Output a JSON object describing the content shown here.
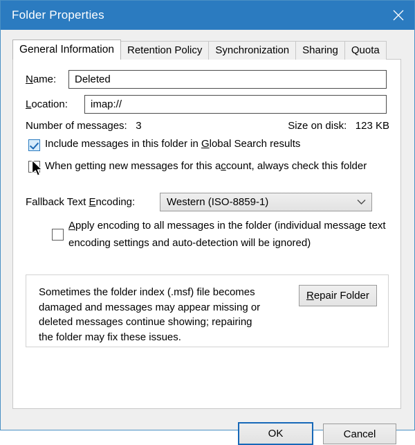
{
  "window": {
    "title": "Folder Properties",
    "close_label": "×",
    "titlebar_color": "#2b7bc0",
    "accent_color": "#1668b8"
  },
  "tabs": [
    {
      "label": "General Information",
      "active": true
    },
    {
      "label": "Retention Policy",
      "active": false
    },
    {
      "label": "Synchronization",
      "active": false
    },
    {
      "label": "Sharing",
      "active": false
    },
    {
      "label": "Quota",
      "active": false
    }
  ],
  "general": {
    "name_label_pre": "N",
    "name_label_accel": "N",
    "name_label": "Name:",
    "name_value": "Deleted",
    "location_label": "Location:",
    "location_value": "imap://",
    "count_label": "Number of messages:",
    "count_value": "3",
    "size_label": "Size on disk:",
    "size_value": "123 KB",
    "checkbox_global_search": {
      "label_a": "Include messages in this folder in ",
      "label_accel": "G",
      "label_b": "lobal Search results",
      "checked": true,
      "hovered": true
    },
    "checkbox_check_folder": {
      "label_a": "When getting new messages for this a",
      "label_accel": "c",
      "label_b": "count, always check this folder",
      "checked": false
    },
    "encoding_label_a": "Fallback Text ",
    "encoding_label_accel": "E",
    "encoding_label_b": "ncoding:",
    "encoding_value": "Western (ISO-8859-1)",
    "encoding_caret": "chevron-down-icon",
    "checkbox_apply_encoding": {
      "label_accel": "A",
      "label_b": "pply encoding to all messages in the folder (individual message text encoding settings and auto-detection will be ignored)",
      "checked": false
    },
    "repair_text": "Sometimes the folder index (.msf) file becomes damaged and messages may appear missing or deleted messages continue showing; repairing the folder may fix these issues.",
    "repair_button_accel": "R",
    "repair_button_rest": "epair Folder"
  },
  "footer": {
    "ok_label": "OK",
    "cancel_label": "Cancel"
  }
}
